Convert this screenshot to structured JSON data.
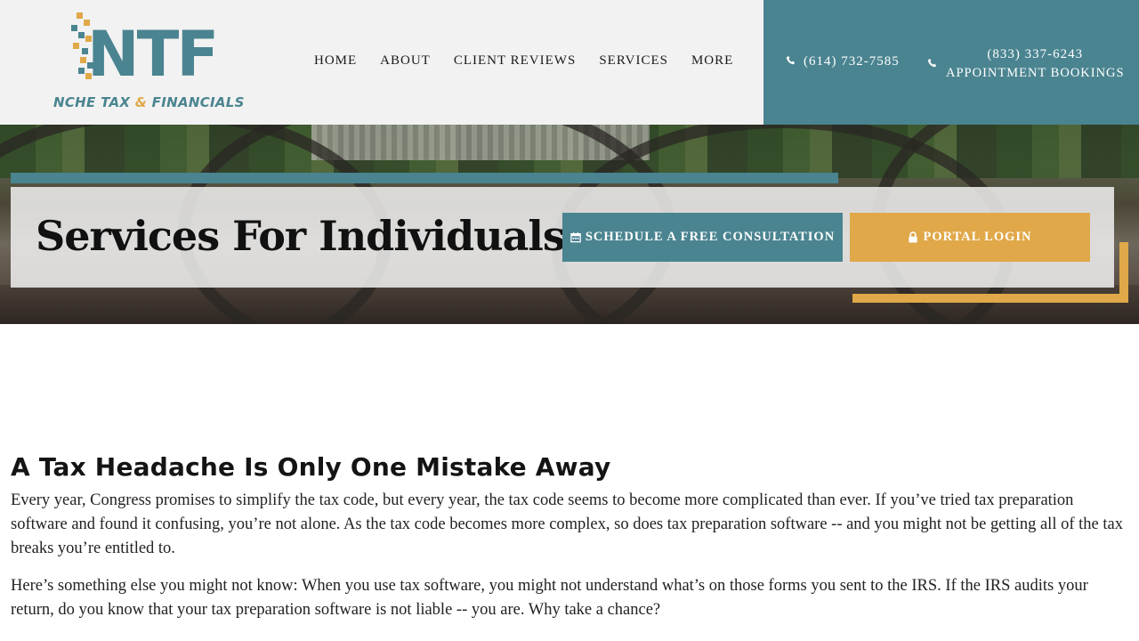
{
  "brand": {
    "logo_mark": "NTF",
    "logo_sub_prefix": "NCHE TAX ",
    "logo_sub_amp": "&",
    "logo_sub_suffix": " FINANCIALS",
    "colors": {
      "teal": "#4a8490",
      "gold": "#e0a848"
    }
  },
  "nav": {
    "items": [
      {
        "label": "HOME"
      },
      {
        "label": "ABOUT"
      },
      {
        "label": "CLIENT REVIEWS"
      },
      {
        "label": "SERVICES"
      },
      {
        "label": "MORE"
      }
    ]
  },
  "contact": {
    "phone_local": "(614) 732-7585",
    "phone_tollfree": "(833) 337-6243",
    "appointments_label": "APPOINTMENT BOOKINGS",
    "icon": "phone-icon"
  },
  "hero": {
    "title": "Services For Individuals",
    "consult_button": "SCHEDULE A FREE CONSULTATION",
    "consult_icon": "calendar-icon",
    "portal_button": "PORTAL LOGIN",
    "portal_icon": "lock-icon"
  },
  "main": {
    "heading": "A Tax Headache Is Only One Mistake Away",
    "paragraphs": [
      "Every year, Congress promises to simplify the tax code, but every year, the tax code seems to become more complicated than ever. If you’ve tried tax preparation software and found it confusing, you’re not alone. As the tax code becomes more complex, so does tax preparation software -- and you might not be getting all of the tax breaks you’re entitled to.",
      "Here’s something else you might not know: When you use tax software, you might not understand what’s on those forms you sent to the IRS. If the IRS audits your return, do you know that your tax preparation software is not liable -- you are. Why take a chance?"
    ]
  }
}
